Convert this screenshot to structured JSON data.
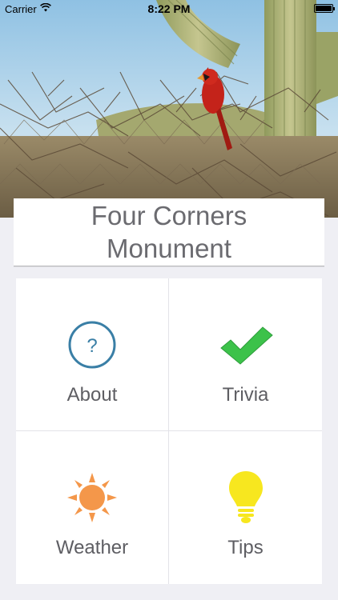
{
  "status_bar": {
    "carrier": "Carrier",
    "time": "8:22 PM"
  },
  "hero": {
    "image_alt": "Cardinal perched in desert brush with saguaro cactus"
  },
  "title": "Four Corners Monument",
  "menu": [
    {
      "label": "About",
      "icon": "question-circle-icon",
      "color": "#3a7fa6"
    },
    {
      "label": "Trivia",
      "icon": "checkmark-icon",
      "color": "#3cc24a"
    },
    {
      "label": "Weather",
      "icon": "sun-icon",
      "color": "#f4974a"
    },
    {
      "label": "Tips",
      "icon": "lightbulb-icon",
      "color": "#f7e71f"
    }
  ],
  "colors": {
    "background": "#efeff4",
    "title_text": "#6b6b70",
    "label_text": "#5e5e63"
  }
}
